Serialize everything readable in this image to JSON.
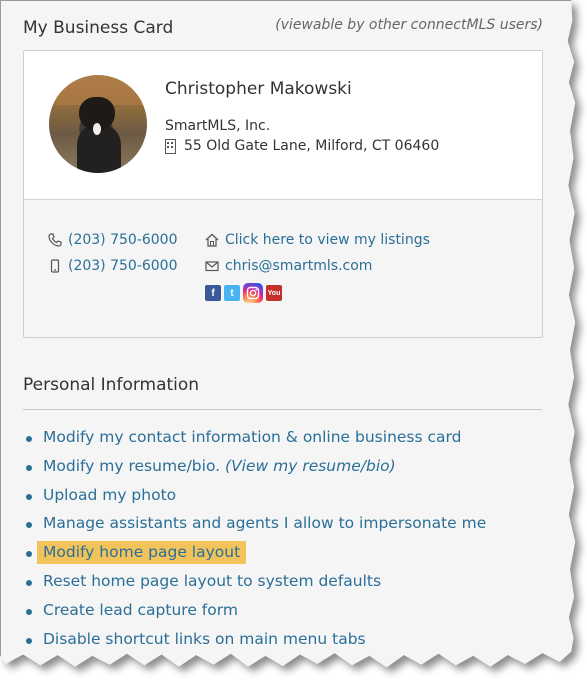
{
  "business_card": {
    "title": "My Business Card",
    "note": "(viewable by other connectMLS users)",
    "name": "Christopher Makowski",
    "company": "SmartMLS, Inc.",
    "address": "55 Old Gate Lane, Milford, CT 06460",
    "phone_office": "(203) 750-6000",
    "phone_mobile": "(203) 750-6000",
    "listings_link": "Click here to view my listings",
    "email": "chris@smartmls.com",
    "social": [
      "facebook-icon",
      "twitter-icon",
      "instagram-icon",
      "youtube-icon"
    ]
  },
  "personal_info": {
    "title": "Personal Information",
    "items": [
      {
        "label": "Modify my contact information & online business card"
      },
      {
        "label": "Modify my resume/bio.",
        "extra": "(View my resume/bio)"
      },
      {
        "label": "Upload my photo"
      },
      {
        "label": "Manage assistants and agents I allow to impersonate me"
      },
      {
        "label": "Modify home page layout",
        "highlighted": true
      },
      {
        "label": "Reset home page layout to system defaults"
      },
      {
        "label": "Create lead capture form"
      },
      {
        "label": "Disable shortcut links on main menu tabs"
      }
    ]
  },
  "colors": {
    "link": "#2a6f97",
    "highlight": "#f2c25b",
    "background": "#f5f5f5"
  }
}
